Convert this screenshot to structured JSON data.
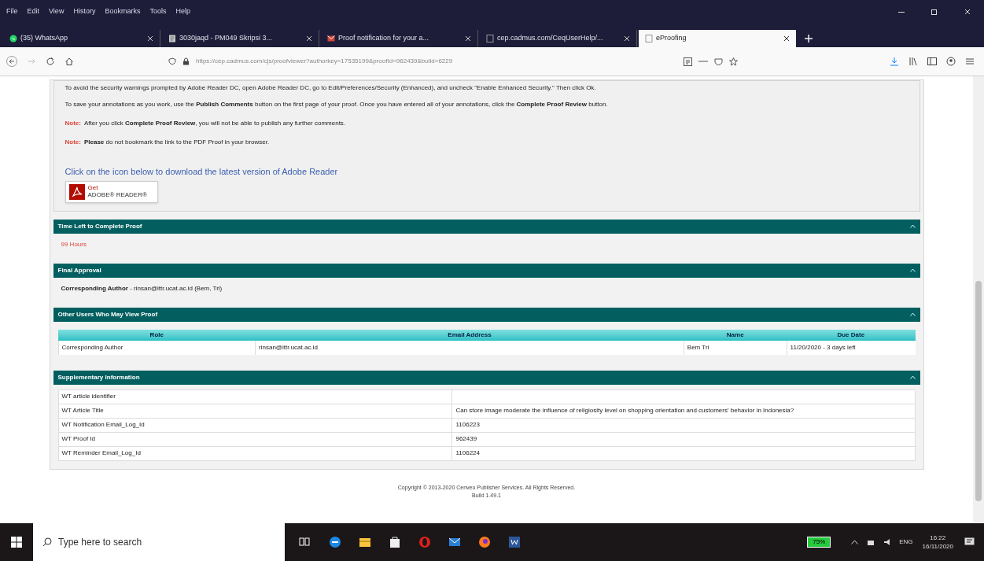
{
  "menu_bar": [
    "File",
    "Edit",
    "View",
    "History",
    "Bookmarks",
    "Tools",
    "Help"
  ],
  "tabs": [
    {
      "label": "(35) WhatsApp",
      "selected": false,
      "kind": "chat"
    },
    {
      "label": "3030jaqd - PM049 Skripsi 3...",
      "selected": false,
      "kind": "document"
    },
    {
      "label": "Proof notification for your a...",
      "selected": false,
      "kind": "mail"
    },
    {
      "label": "cep.cadmus.com/CeqUserHelp/...",
      "selected": false,
      "kind": "page"
    },
    {
      "label": "eProofing",
      "selected": true,
      "kind": "page"
    }
  ],
  "address_bar": {
    "url": "https://cep.cadmus.com/cjs/proofviewer?authorkey=17535199&proofId=962439&build=6229"
  },
  "instructions": [
    {
      "kind": "text",
      "text": "To avoid the security warnings prompted by Adobe Reader DC, open Adobe Reader DC, go to Edit/Preferences/Security (Enhanced), and uncheck \"Enable Enhanced Security.\" Then click Ok."
    },
    {
      "kind": "text",
      "text": "To save your annotations as you work, use the **Publish Comments** button on the first page of your proof. Once you have entered all of your annotations, click the **Complete Proof Review** button."
    },
    {
      "kind": "note",
      "label": "Note:",
      "text": "After you click **Complete Proof Review**, you will not be able to publish any further comments."
    },
    {
      "kind": "note",
      "label": "Note:",
      "text": "**Please** do not bookmark the link to the PDF Proof in your browser."
    }
  ],
  "download_link": "Click on the icon below to download the latest version of Adobe Reader",
  "adobe_badge": {
    "line_1": "Get",
    "line_2": "ADOBE® READER®"
  },
  "sections": [
    {
      "title": "Time Left to Complete Proof",
      "expanded": true,
      "kind": "time",
      "text": "99 Hours"
    },
    {
      "title": "Final Approval",
      "expanded": true,
      "kind": "approval",
      "text": "**Corresponding Author** - rinsan@ittr.ucat.ac.id (Bem, Tri)"
    },
    {
      "title": "Other Users Who May View Proof",
      "expanded": true,
      "kind": "table",
      "columns": [
        "Role",
        "Email Address",
        "Name",
        "Due Date"
      ],
      "rows": [
        [
          "Corresponding Author",
          "rinsan@ittr.ucat.ac.id",
          "Bem Tri",
          "11/20/2020 - 3 days left"
        ]
      ]
    },
    {
      "title": "Supplementary Information",
      "expanded": true,
      "kind": "info",
      "rows": [
        [
          "WT article identifier"
        ],
        [
          "WT Article Title",
          "Can store image moderate the influence of religiosity level on shopping orientation and customers' behavior in Indonesia?"
        ],
        [
          "WT Notification Email_Log_Id",
          "1106223"
        ],
        [
          "WT Proof Id",
          "962439"
        ],
        [
          "WT Reminder Email_Log_Id",
          "1106224"
        ]
      ]
    }
  ],
  "footer": {
    "copyright": "Copyright © 2013-2020 Cenveo Publisher Services. All Rights Reserved.",
    "build": "Build 1.49.1"
  },
  "taskbar": {
    "search_placeholder": "Type here to search",
    "battery": "75%",
    "language": "ENG",
    "time": "16:22",
    "date": "16/11/2020"
  }
}
